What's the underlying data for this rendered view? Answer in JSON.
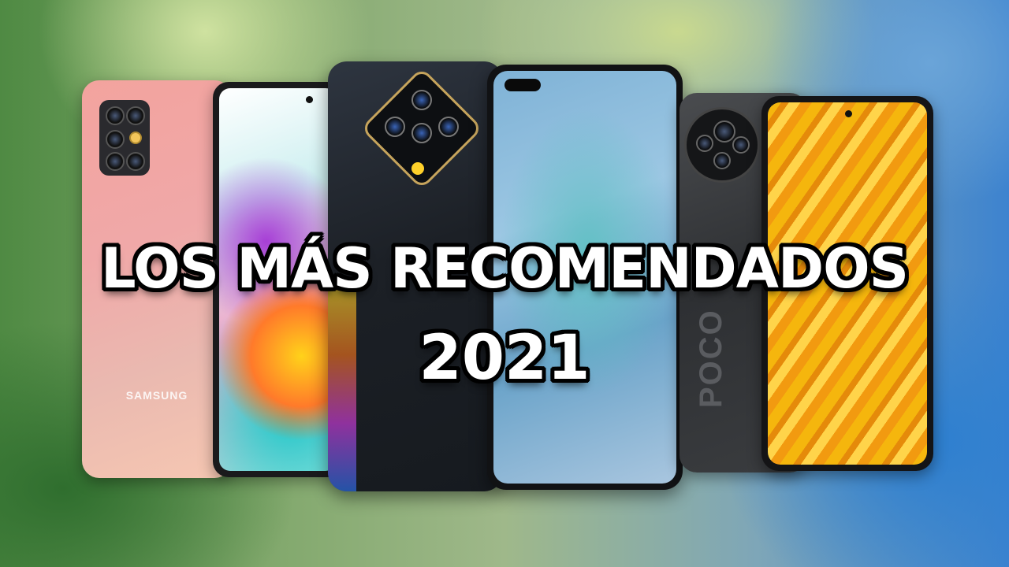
{
  "headline": {
    "line1": "LOS MÁS RECOMENDADOS",
    "line2": "2021"
  },
  "phones": {
    "samsung_brand": "SAMSUNG",
    "poco_logo": "POCO"
  },
  "colors": {
    "headline_text": "#ffffff",
    "headline_outline": "#000000",
    "samsung_back": "#f0a8a8",
    "poco_screen": "#f5b60d"
  }
}
